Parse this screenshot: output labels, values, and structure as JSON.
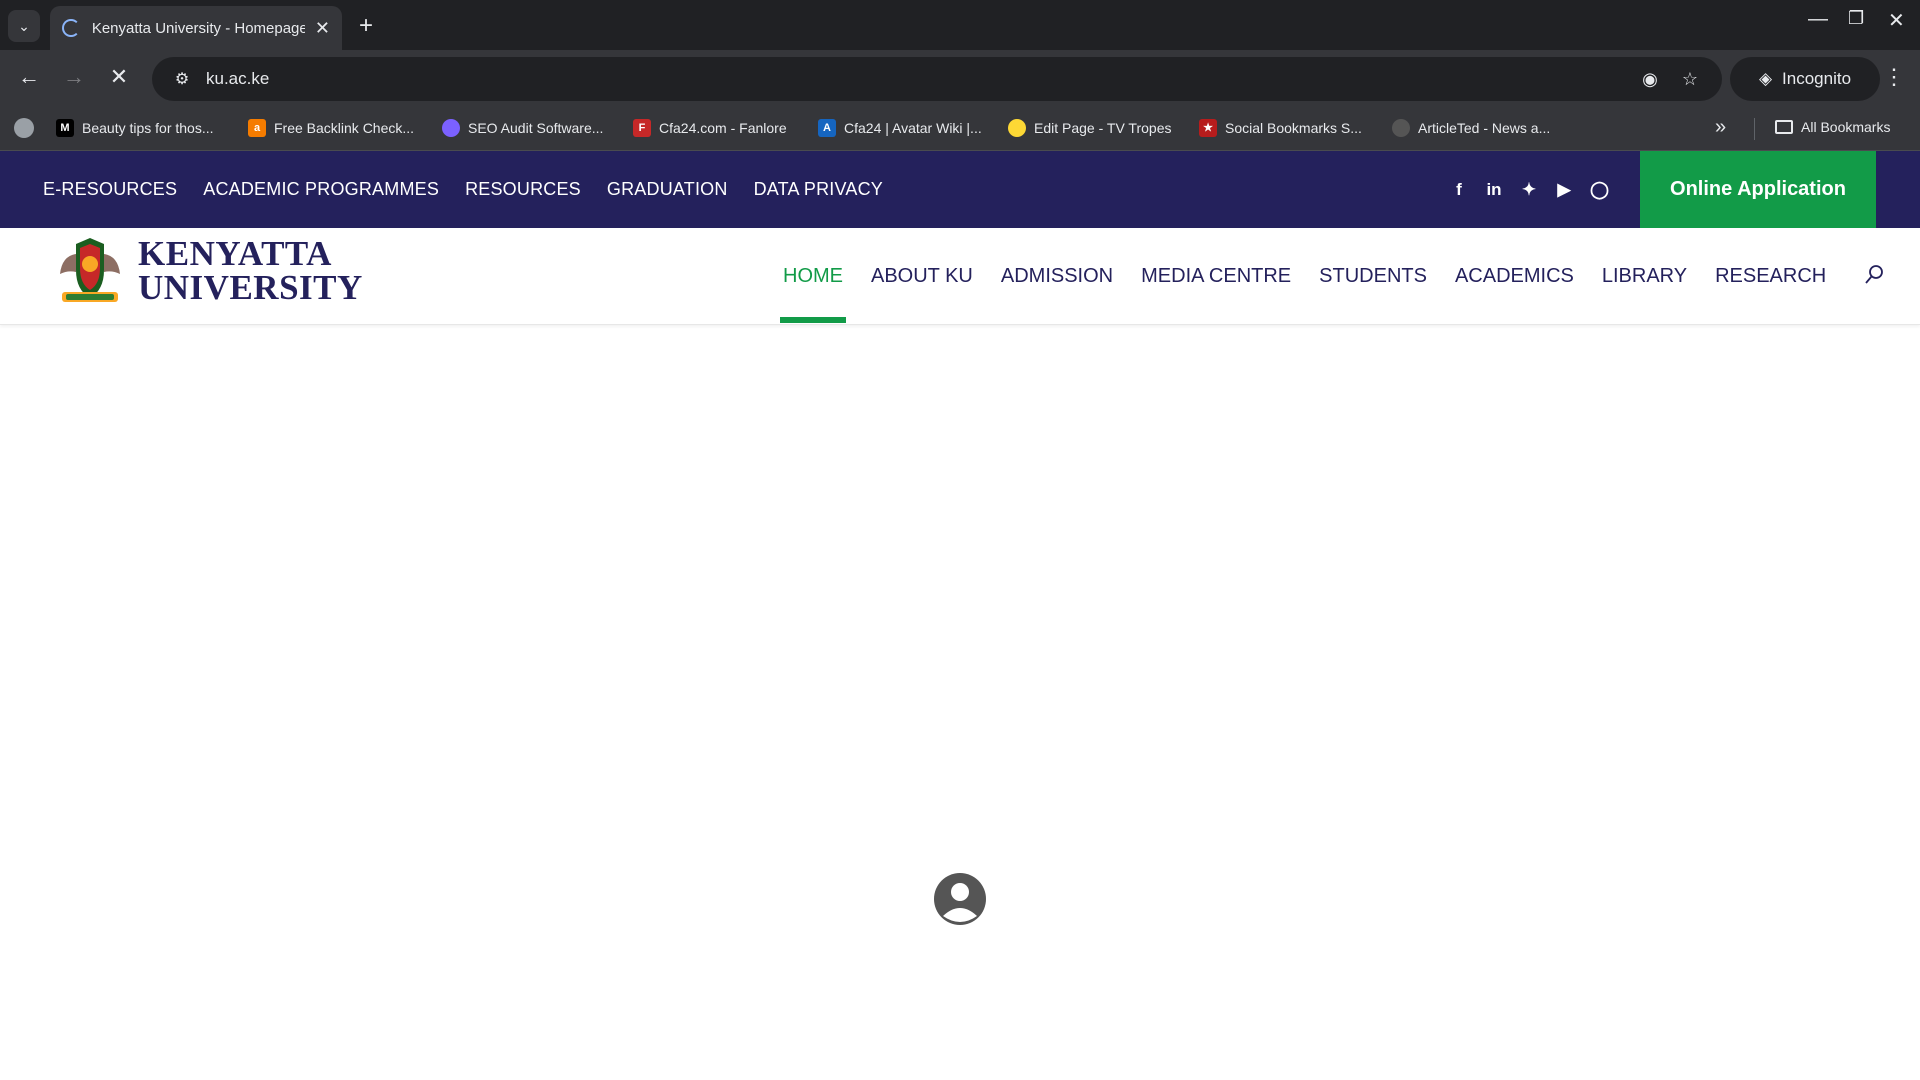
{
  "browser": {
    "tab_title": "Kenyatta University - Homepage",
    "url": "ku.ac.ke",
    "incognito_label": "Incognito",
    "bookmarks": [
      {
        "label": "Beauty tips for thos...",
        "icon": "medium-icon",
        "color": "#000000"
      },
      {
        "label": "Free Backlink Check...",
        "icon": "ahrefs-icon",
        "color": "#f57c00"
      },
      {
        "label": "SEO Audit Software...",
        "icon": "seo-icon",
        "color": "#7b61ff"
      },
      {
        "label": "Cfa24.com - Fanlore",
        "icon": "fanlore-icon",
        "color": "#c62828"
      },
      {
        "label": "Cfa24 | Avatar Wiki |...",
        "icon": "wiki-icon",
        "color": "#1565c0"
      },
      {
        "label": "Edit Page - TV Tropes",
        "icon": "tvtropes-icon",
        "color": "#fdd835"
      },
      {
        "label": "Social Bookmarks S...",
        "icon": "social-icon",
        "color": "#b71c1c"
      },
      {
        "label": "ArticleTed - News a...",
        "icon": "articleted-icon",
        "color": "#555555"
      }
    ],
    "all_bookmarks_label": "All Bookmarks"
  },
  "site": {
    "top_nav": [
      "E-RESOURCES",
      "ACADEMIC PROGRAMMES",
      "RESOURCES",
      "GRADUATION",
      "DATA PRIVACY"
    ],
    "social_icons": [
      "facebook-icon",
      "linkedin-icon",
      "twitter-icon",
      "youtube-icon",
      "instagram-icon"
    ],
    "apply_label": "Online Application",
    "logo_line1": "KENYATTA",
    "logo_line2": "UNIVERSITY",
    "main_nav": [
      "HOME",
      "ABOUT KU",
      "ADMISSION",
      "MEDIA CENTRE",
      "STUDENTS",
      "ACADEMICS",
      "LIBRARY",
      "RESEARCH"
    ],
    "active_nav": "HOME",
    "colors": {
      "brand_navy": "#24215c",
      "brand_green": "#129b48"
    }
  }
}
